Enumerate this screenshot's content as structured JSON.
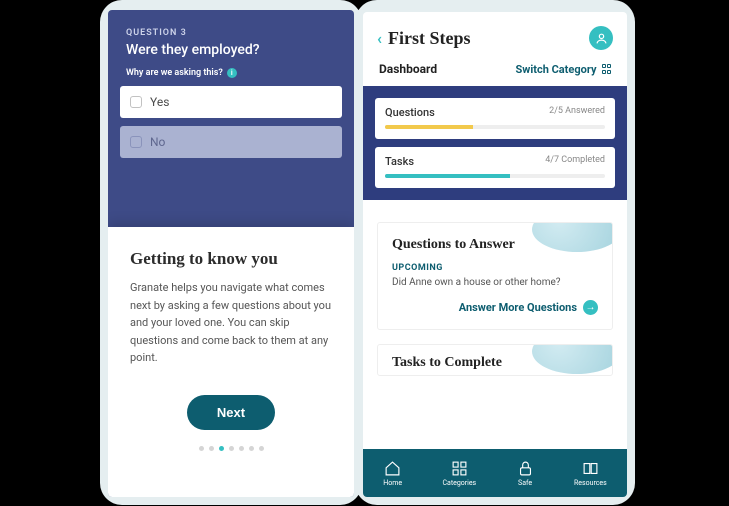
{
  "left": {
    "question_num": "QUESTION 3",
    "question_text": "Were they employed?",
    "why_label": "Why are we asking this?",
    "opt_yes": "Yes",
    "opt_no": "No",
    "sheet_title": "Getting to know you",
    "sheet_body": "Granate helps you navigate what comes next by asking a few questions about you and your loved one. You can skip questions and come back to them at any point.",
    "next": "Next"
  },
  "right": {
    "title": "First Steps",
    "dashboard": "Dashboard",
    "switch": "Switch Category",
    "summary": {
      "questions_label": "Questions",
      "questions_stat": "2/5 Answered",
      "tasks_label": "Tasks",
      "tasks_stat": "4/7 Completed"
    },
    "qa": {
      "heading": "Questions to Answer",
      "label": "UPCOMING",
      "body": "Did Anne own a house or other home?",
      "cta": "Answer More Questions"
    },
    "tasks_heading": "Tasks to Complete",
    "nav": {
      "home": "Home",
      "categories": "Categories",
      "safe": "Safe",
      "resources": "Resources"
    }
  }
}
